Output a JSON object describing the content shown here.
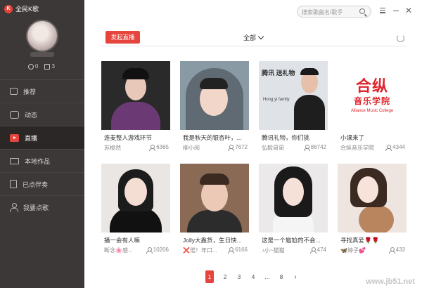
{
  "app": {
    "title": "全民K歌"
  },
  "profile": {
    "stats": [
      {
        "icon": "clock-icon",
        "value": "0"
      },
      {
        "icon": "medal-icon",
        "value": "3"
      }
    ]
  },
  "sidebar": {
    "items": [
      {
        "label": "推荐",
        "icon": "thumbs-up-icon"
      },
      {
        "label": "动态",
        "icon": "chat-icon"
      },
      {
        "label": "直播",
        "icon": "live-icon",
        "active": true
      },
      {
        "label": "本地作品",
        "icon": "monitor-icon"
      },
      {
        "label": "已点伴奏",
        "icon": "document-icon"
      },
      {
        "label": "我要点歌",
        "icon": "person-icon"
      }
    ]
  },
  "header": {
    "search_placeholder": "搜索歌曲名/歌手"
  },
  "toolbar": {
    "start_live_label": "发起直播",
    "filter_label": "全部"
  },
  "cards": [
    {
      "title": "连麦整人游戏环节",
      "owner": "苏梭然",
      "viewers": "6365"
    },
    {
      "title": "我是秋天的银杏叶，...",
      "owner": "柳小阅",
      "viewers": "7672"
    },
    {
      "title": "腾讯礼物，你们挑",
      "owner": "弘毅哥哥",
      "viewers": "86742"
    },
    {
      "title": "小课来了",
      "owner": "合纵音乐学院",
      "viewers": "4344"
    },
    {
      "title": "播一会有人嘛",
      "owner": "断念🌸感...",
      "viewers": "10206"
    },
    {
      "title": "Jolly大鑫货，生日快...",
      "owner": "❌偌！年口...",
      "viewers": "6166"
    },
    {
      "title": "这是一个尴尬的不会...",
      "owner": "♪小~猫猫",
      "viewers": "474"
    },
    {
      "title": "寻找真爱🌹🌹",
      "owner": "🦋婷子💕",
      "viewers": "433"
    }
  ],
  "school_logo": {
    "line1": "合纵",
    "line2": "音乐学院",
    "line3": "Alliance Music College"
  },
  "thumb_art": {
    "card3_text": "腾讯 送礼物",
    "card3_sub": "Hong yi family"
  },
  "pagination": {
    "pages": [
      "1",
      "2",
      "3",
      "4",
      "...",
      "8"
    ],
    "current": "1",
    "next": "›"
  },
  "watermark": "www.jb51.net",
  "colors": {
    "accent": "#e6453d",
    "sidebar_bg": "#3d3838"
  }
}
